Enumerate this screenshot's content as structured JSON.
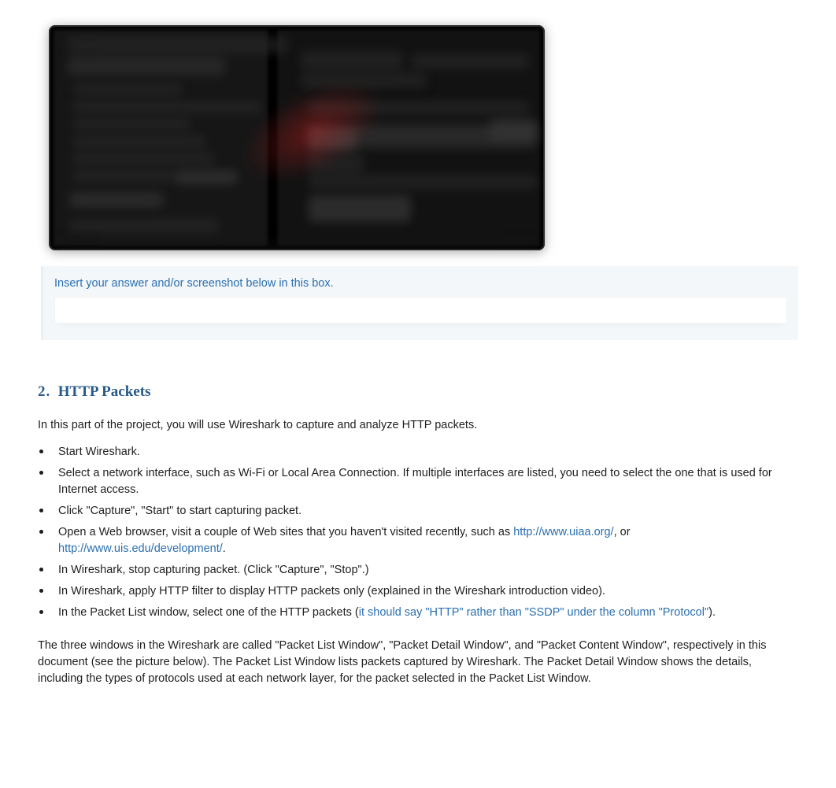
{
  "answer_box": {
    "hint": "Insert your answer and/or screenshot below in this box.",
    "value": ""
  },
  "section": {
    "number": "2.",
    "title": "HTTP Packets"
  },
  "intro": "In this part of the project, you will use Wireshark to capture and analyze HTTP packets.",
  "bullets": [
    {
      "text": "Start Wireshark."
    },
    {
      "text": "Select a network interface, such as Wi-Fi or Local Area Connection. If multiple interfaces are listed, you need to select the one that is used for Internet access."
    },
    {
      "text": "Click \"Capture\", \"Start\" to start capturing packet."
    },
    {
      "prefix": "Open a Web browser, visit a couple of Web sites that you haven't visited recently, such as ",
      "link1": "http://www.uiaa.org/",
      "mid": ", or ",
      "link2": "http://www.uis.edu/development/",
      "suffix": "."
    },
    {
      "text": "In Wireshark, stop capturing packet. (Click \"Capture\", \"Stop\".)"
    },
    {
      "text": "In Wireshark, apply HTTP filter to display HTTP packets only (explained in the Wireshark introduction video)."
    },
    {
      "prefix": "In the Packet List window, select one of the HTTP packets (",
      "note": "it should say \"HTTP\" rather than \"SSDP\" under the column \"Protocol\"",
      "suffix": ")."
    }
  ],
  "paragraph": "The three windows in the Wireshark are called \"Packet List Window\", \"Packet Detail Window\", and \"Packet Content Window\", respectively in this document (see the picture below). The Packet List Window lists packets captured by Wireshark. The Packet Detail Window shows the details, including the types of protocols used at each network layer, for the packet selected in the Packet List Window."
}
